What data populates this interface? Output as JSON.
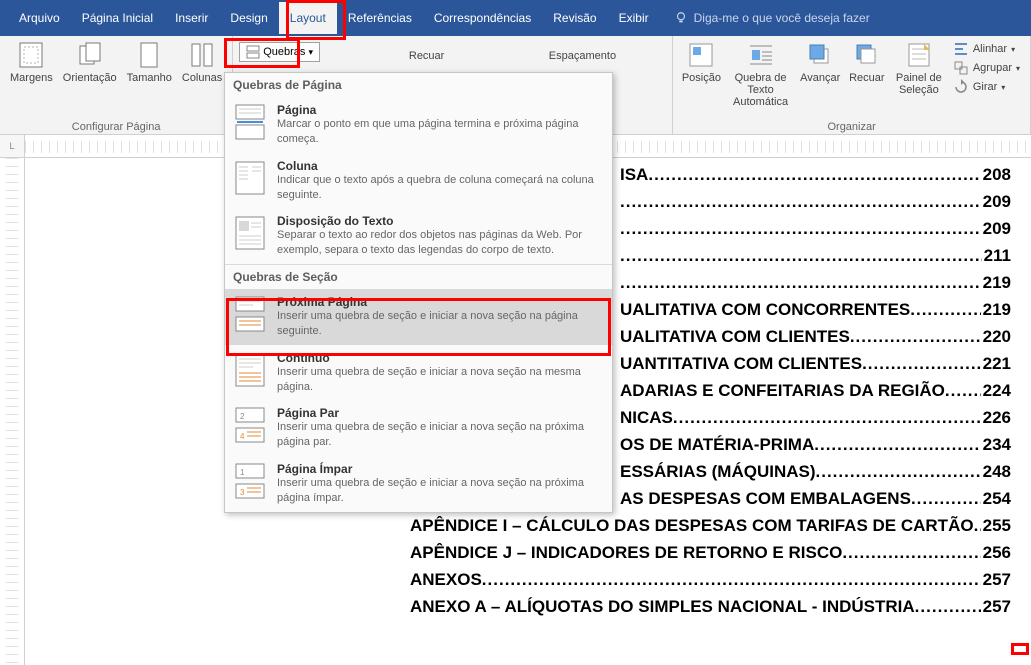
{
  "menubar": {
    "tabs": [
      "Arquivo",
      "Página Inicial",
      "Inserir",
      "Design",
      "Layout",
      "Referências",
      "Correspondências",
      "Revisão",
      "Exibir"
    ],
    "active_index": 4,
    "tell_me": "Diga-me o que você deseja fazer"
  },
  "ribbon": {
    "page_setup": {
      "margens": "Margens",
      "orientacao": "Orientação",
      "tamanho": "Tamanho",
      "colunas": "Colunas",
      "group_label": "Configurar Página"
    },
    "quebras_button": "Quebras",
    "paragraph_headers": {
      "recuar": "Recuar",
      "espacamento": "Espaçamento"
    },
    "arrange": {
      "posicao": "Posição",
      "quebra_texto": "Quebra de Texto Automática",
      "avancar": "Avançar",
      "recuar": "Recuar",
      "painel": "Painel de Seleção",
      "alinhar": "Alinhar",
      "agrupar": "Agrupar",
      "girar": "Girar",
      "group_label": "Organizar"
    }
  },
  "dropdown": {
    "section1_title": "Quebras de Página",
    "section2_title": "Quebras de Seção",
    "items_page": [
      {
        "title": "Página",
        "desc": "Marcar o ponto em que uma página termina e próxima página começa."
      },
      {
        "title": "Coluna",
        "desc": "Indicar que o texto após a quebra de coluna começará na coluna seguinte."
      },
      {
        "title": "Disposição do Texto",
        "desc": "Separar o texto ao redor dos objetos nas páginas da Web. Por exemplo, separa o texto das legendas do corpo de texto."
      }
    ],
    "items_section": [
      {
        "title": "Próxima Página",
        "desc": "Inserir uma quebra de seção e iniciar a nova seção na página seguinte."
      },
      {
        "title": "Contínuo",
        "desc": "Inserir uma quebra de seção e iniciar a nova seção na mesma página."
      },
      {
        "title": "Página Par",
        "desc": "Inserir uma quebra de seção e iniciar a nova seção na próxima página par."
      },
      {
        "title": "Página Ímpar",
        "desc": "Inserir uma quebra de seção e iniciar a nova seção na próxima página ímpar."
      }
    ]
  },
  "toc": [
    {
      "text": "ISA",
      "page": "208"
    },
    {
      "text": "",
      "page": "209"
    },
    {
      "text": "",
      "page": "209"
    },
    {
      "text": "",
      "page": "211"
    },
    {
      "text": "",
      "page": "219"
    },
    {
      "text": "UALITATIVA COM CONCORRENTES ",
      "page": "219"
    },
    {
      "text": "UALITATIVA COM CLIENTES ",
      "page": "220"
    },
    {
      "text": "UANTITATIVA COM CLIENTES ",
      "page": "221"
    },
    {
      "text": "ADARIAS E CONFEITARIAS DA REGIÃO ",
      "page": "224"
    },
    {
      "text": "NICAS ",
      "page": "226"
    },
    {
      "text": "OS DE MATÉRIA-PRIMA ",
      "page": "234"
    },
    {
      "text": "ESSÁRIAS (MÁQUINAS)",
      "page": "248"
    },
    {
      "text": "AS DESPESAS COM EMBALAGENS ",
      "page": "254"
    },
    {
      "text": "APÊNDICE I – CÁLCULO DAS DESPESAS COM TARIFAS DE CARTÃO ",
      "page": "255",
      "full": true
    },
    {
      "text": "APÊNDICE J – INDICADORES DE RETORNO E RISCO",
      "page": "256",
      "full": true
    },
    {
      "text": "ANEXOS",
      "page": "257",
      "full": true
    },
    {
      "text": "ANEXO A – ALÍQUOTAS DO SIMPLES NACIONAL - INDÚSTRIA",
      "page": "257",
      "full": true
    }
  ],
  "ruler_corner": "L"
}
